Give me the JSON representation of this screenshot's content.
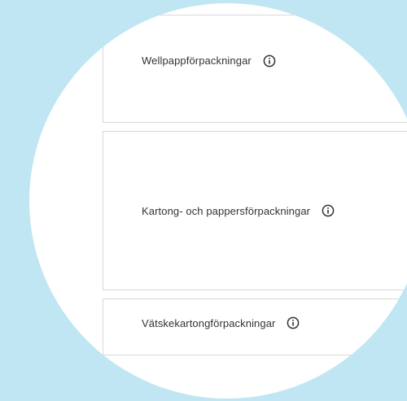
{
  "colors": {
    "background": "#bfe6f2",
    "lens": "#ffffff",
    "card_border": "#d9d9d9",
    "text": "#333333"
  },
  "options": [
    {
      "label": "Wellpappförpackningar",
      "icon": "info-icon"
    },
    {
      "label": "Kartong- och pappersförpackningar",
      "icon": "info-icon"
    },
    {
      "label": "Vätskekartongförpackningar",
      "icon": "info-icon"
    }
  ]
}
